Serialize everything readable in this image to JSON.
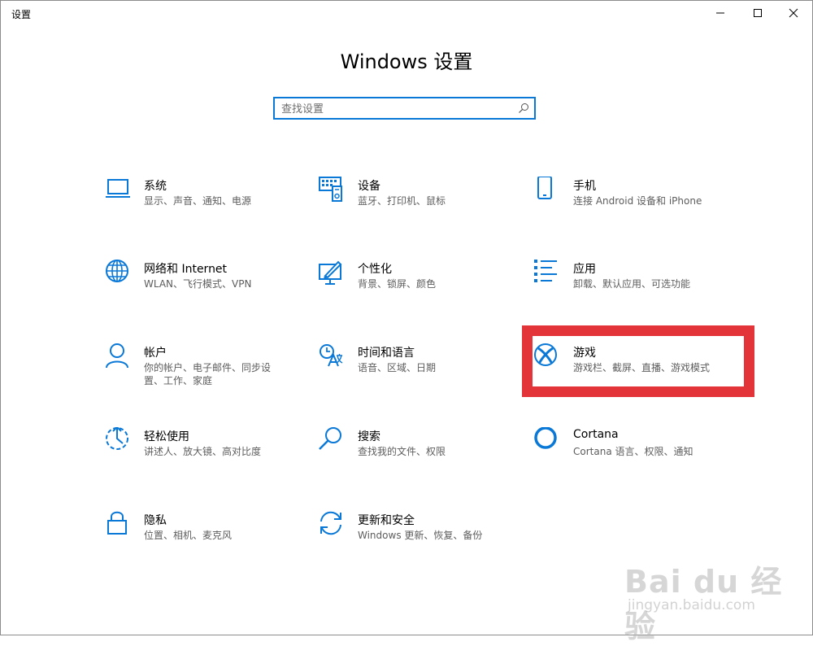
{
  "window": {
    "title": "设置",
    "controls": [
      "minimize-icon",
      "maximize-icon",
      "close-icon"
    ]
  },
  "header": {
    "title": "Windows 设置"
  },
  "search": {
    "placeholder": "查找设置",
    "value": ""
  },
  "accent_color": "#0a78d7",
  "highlight_color": "#e33439",
  "tiles": [
    {
      "title": "系统",
      "subtitle": "显示、声音、通知、电源",
      "icon": "laptop-icon"
    },
    {
      "title": "设备",
      "subtitle": "蓝牙、打印机、鼠标",
      "icon": "keyboard-icon"
    },
    {
      "title": "手机",
      "subtitle": "连接 Android 设备和 iPhone",
      "icon": "phone-icon"
    },
    {
      "title": "网络和 Internet",
      "subtitle": "WLAN、飞行模式、VPN",
      "icon": "globe-icon"
    },
    {
      "title": "个性化",
      "subtitle": "背景、锁屏、颜色",
      "icon": "paint-icon"
    },
    {
      "title": "应用",
      "subtitle": "卸载、默认应用、可选功能",
      "icon": "apps-list-icon"
    },
    {
      "title": "帐户",
      "subtitle": "你的帐户、电子邮件、同步设置、工作、家庭",
      "icon": "person-icon"
    },
    {
      "title": "时间和语言",
      "subtitle": "语音、区域、日期",
      "icon": "time-language-icon"
    },
    {
      "title": "游戏",
      "subtitle": "游戏栏、截屏、直播、游戏模式",
      "icon": "xbox-icon"
    },
    {
      "title": "轻松使用",
      "subtitle": "讲述人、放大镜、高对比度",
      "icon": "ease-of-access-icon"
    },
    {
      "title": "搜索",
      "subtitle": "查找我的文件、权限",
      "icon": "search-icon"
    },
    {
      "title": "Cortana",
      "subtitle": "Cortana 语言、权限、通知",
      "icon": "cortana-icon"
    },
    {
      "title": "隐私",
      "subtitle": "位置、相机、麦克风",
      "icon": "lock-icon"
    },
    {
      "title": "更新和安全",
      "subtitle": "Windows 更新、恢复、备份",
      "icon": "sync-icon"
    }
  ],
  "watermark": {
    "logo": "Bai du 经验",
    "url": "jingyan.baidu.com"
  }
}
